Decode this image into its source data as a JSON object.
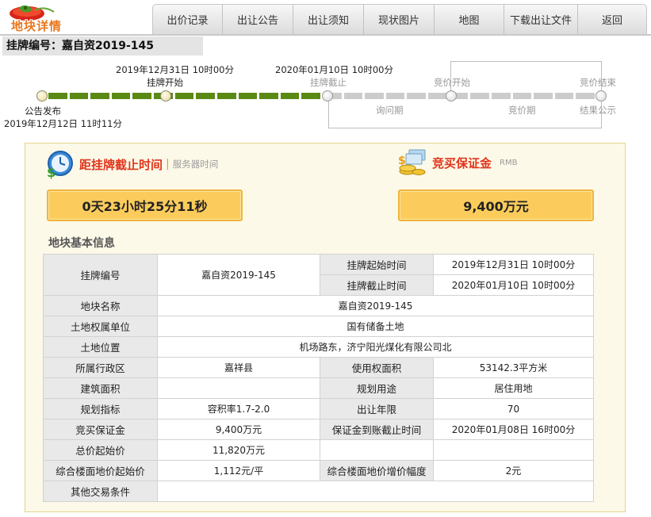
{
  "header": {
    "logo_text": "地块详情",
    "nav": [
      "出价记录",
      "出让公告",
      "出让须知",
      "现状图片",
      "地图",
      "下载出让文件",
      "返回"
    ],
    "listing_number_label": "挂牌编号：嘉自资2019-145"
  },
  "timeline": {
    "stage_announce": "公告发布",
    "announce_time": "2019年12月12日 11时11分",
    "stage_listing_start": "挂牌开始",
    "listing_start_time": "2019年12月31日 10时00分",
    "stage_listing_end": "挂牌截止",
    "listing_end_time": "2020年01月10日 10时00分",
    "stage_bid_start": "竞价开始",
    "stage_bid_end": "竞价结束",
    "period_inquiry": "询问期",
    "period_bidding": "竞价期",
    "stage_result": "结果公示"
  },
  "countdown": {
    "title": "距挂牌截止时间",
    "separator": "|",
    "subtitle": "服务器时间",
    "value": "0天23小时25分11秒"
  },
  "deposit": {
    "title": "竞买保证金",
    "subtitle": "RMB",
    "value": "9,400万元"
  },
  "basic_info": {
    "section_title": "地块基本信息",
    "rows": {
      "listing_no_label": "挂牌编号",
      "listing_no": "嘉自资2019-145",
      "listing_start_label": "挂牌起始时间",
      "listing_start": "2019年12月31日 10时00分",
      "listing_end_label": "挂牌截止时间",
      "listing_end": "2020年01月10日 10时00分",
      "parcel_name_label": "地块名称",
      "parcel_name": "嘉自资2019-145",
      "owner_label": "土地权属单位",
      "owner": "国有储备土地",
      "location_label": "土地位置",
      "location": "机场路东，济宁阳光煤化有限公司北",
      "district_label": "所属行政区",
      "district": "嘉祥县",
      "use_area_label": "使用权面积",
      "use_area": "53142.3平方米",
      "building_area_label": "建筑面积",
      "building_area": "",
      "planned_use_label": "规划用途",
      "planned_use": "居住用地",
      "planning_index_label": "规划指标",
      "planning_index": "容积率1.7-2.0",
      "term_label": "出让年限",
      "term": "70",
      "deposit_label": "竞买保证金",
      "deposit": "9,400万元",
      "deposit_deadline_label": "保证金到账截止时间",
      "deposit_deadline": "2020年01月08日 16时00分",
      "total_start_label": "总价起始价",
      "total_start": "11,820万元",
      "floor_price_label": "综合楼面地价起始价",
      "floor_price": "1,112元/平",
      "increment_label": "综合楼面地价增价幅度",
      "increment": "2元",
      "other_label": "其他交易条件",
      "other": ""
    }
  },
  "colors": {
    "progress_done": "#5a8a14",
    "progress_todo": "#cccccc",
    "accent_red": "#e0351c",
    "value_box": "#fbcc5c",
    "panel_bg": "#fcf9e8"
  },
  "timeline_progress": {
    "segments_total": 26,
    "segments_done": 13
  }
}
